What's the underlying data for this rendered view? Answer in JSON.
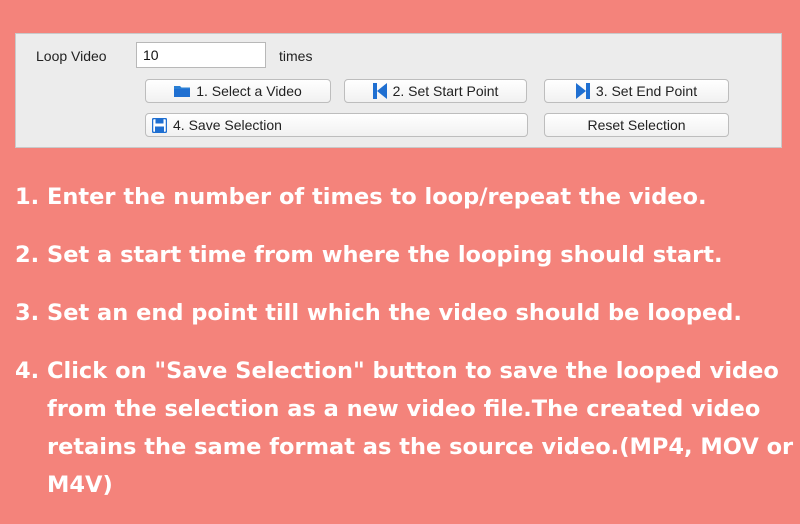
{
  "panel": {
    "loop_label": "Loop Video",
    "loop_value": "10",
    "times_label": "times",
    "buttons": {
      "select_video": {
        "label": "1. Select a Video",
        "icon": "folder-icon"
      },
      "set_start": {
        "label": "2. Set Start Point",
        "icon": "skip-back-icon"
      },
      "set_end": {
        "label": "3. Set End Point",
        "icon": "skip-forward-icon"
      },
      "save_selection": {
        "label": "4. Save Selection",
        "icon": "floppy-disk-icon"
      },
      "reset_selection": {
        "label": "Reset Selection"
      }
    }
  },
  "instructions": [
    {
      "num": "1.",
      "text": "Enter the number of times to loop/repeat the video."
    },
    {
      "num": "2.",
      "text": "Set a start time from where the looping should start."
    },
    {
      "num": "3.",
      "text": "Set an end point till which the video should be looped."
    },
    {
      "num": "4.",
      "text": "Click on \"Save Selection\" button to save the looped video from the selection as a new video file.The created video retains the same format as the source video.(MP4, MOV or M4V)"
    }
  ],
  "colors": {
    "background": "#f4837b",
    "panel": "#ececec",
    "icon_blue": "#1f6fd1",
    "text_white": "#ffffff"
  }
}
